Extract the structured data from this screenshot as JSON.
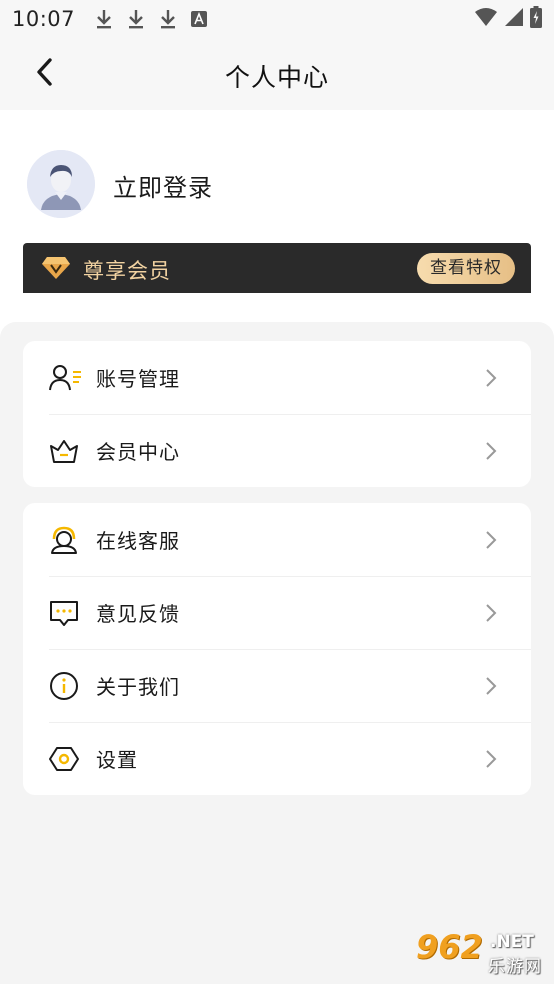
{
  "status_bar": {
    "time": "10:07",
    "notification_icons": [
      "download-icon",
      "download-icon",
      "download-icon",
      "font-a-icon"
    ],
    "right_icons": [
      "wifi-icon",
      "signal-icon",
      "battery-icon"
    ]
  },
  "nav": {
    "title": "个人中心",
    "back_icon": "chevron-left-icon"
  },
  "profile": {
    "login_text": "立即登录",
    "avatar_icon": "default-avatar-icon"
  },
  "vip": {
    "label": "尊享会员",
    "button_label": "查看特权",
    "icon": "diamond-icon",
    "colors": {
      "banner_bg": "#2a2a2a",
      "label": "#f2d3a2",
      "button_from": "#f7dcae",
      "button_to": "#e6bf86"
    }
  },
  "menu": {
    "group1": [
      {
        "label": "账号管理",
        "icon": "account-manage-icon"
      },
      {
        "label": "会员中心",
        "icon": "member-center-icon"
      }
    ],
    "group2": [
      {
        "label": "在线客服",
        "icon": "customer-service-icon"
      },
      {
        "label": "意见反馈",
        "icon": "feedback-icon"
      },
      {
        "label": "关于我们",
        "icon": "info-icon"
      },
      {
        "label": "设置",
        "icon": "settings-icon"
      }
    ]
  },
  "watermark": {
    "number": "962",
    "domain": ".NET",
    "name": "乐游网"
  },
  "accent_color": "#f5b800"
}
